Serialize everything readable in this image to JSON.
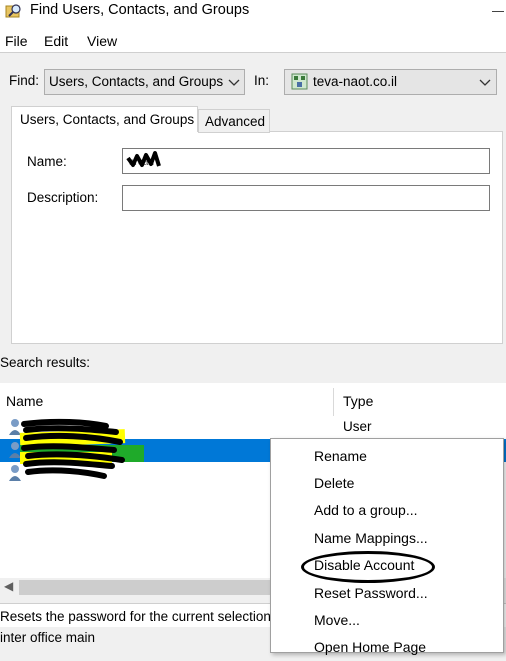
{
  "window": {
    "title": "Find Users, Contacts, and Groups"
  },
  "menu": [
    "File",
    "Edit",
    "View"
  ],
  "find": {
    "find_label": "Find:",
    "find_value": "Users, Contacts, and Groups",
    "in_label": "In:",
    "in_value": "teva-naot.co.il"
  },
  "tabs": [
    {
      "label": "Users, Contacts, and Groups",
      "active": true
    },
    {
      "label": "Advanced",
      "active": false
    }
  ],
  "form": {
    "name_label": "Name:",
    "name_value": "arcan",
    "description_label": "Description:",
    "description_value": ""
  },
  "results": {
    "label": "Search results:",
    "columns": [
      "Name",
      "Type"
    ],
    "rows": [
      {
        "name": "",
        "type": "User"
      },
      {
        "name": "",
        "type": "",
        "selected": true
      },
      {
        "name": "",
        "type": ""
      }
    ]
  },
  "context_menu": {
    "items": [
      "Rename",
      "Delete",
      "Add to a group...",
      "Name Mappings...",
      "Disable Account",
      "Reset Password...",
      "Move...",
      "Open Home Page"
    ],
    "circled_item": "Disable Account"
  },
  "status": {
    "description": "Resets the password for the current selection",
    "line2": "inter office main"
  },
  "colors": {
    "selection": "#0078d7",
    "highlight": "#ffff00"
  },
  "icons": [
    "search-folder-icon",
    "domain-icon",
    "user-icon",
    "chevron-down-icon"
  ]
}
